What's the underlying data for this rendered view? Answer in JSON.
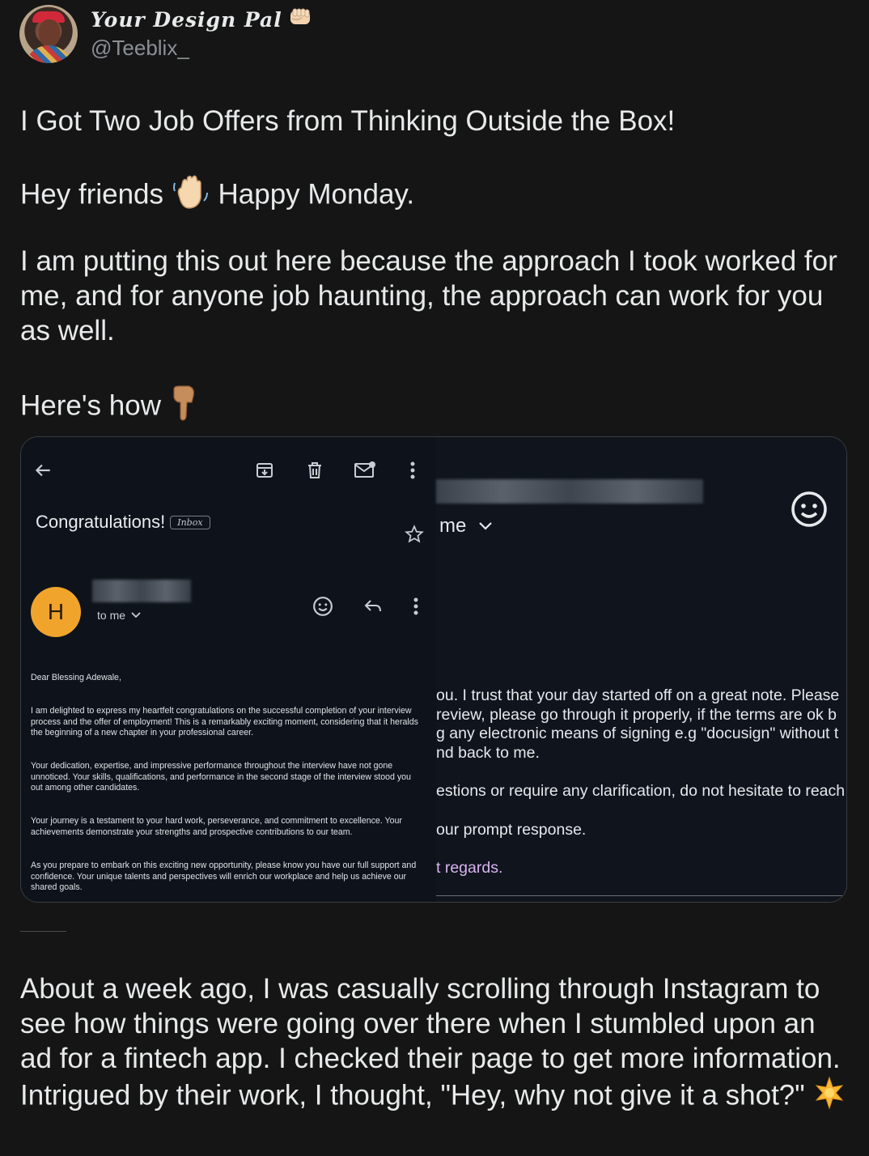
{
  "author": {
    "display_name": "Your Design Pal",
    "handle": "@Teeblix_"
  },
  "post": {
    "headline": "I Got Two Job Offers from Thinking Outside the Box!",
    "greeting_a": "Hey friends",
    "greeting_b": "Happy Monday.",
    "body_1": "I am putting this out here because the approach I took worked for me, and for anyone job haunting, the approach can work for you as well.",
    "cta": "Here's how",
    "body_2": "About a week ago, I was casually scrolling through Instagram to see how things were going over there when I stumbled upon an ad for a fintech app. I checked their page to get more information. Intrigued by their work, I thought, \"Hey, why not give it a shot?\""
  },
  "email_left": {
    "subject": "Congratulations!",
    "label": "Inbox",
    "sender_initial": "H",
    "recipient": "to me",
    "salutation": "Dear Blessing Adewale,",
    "p1": "I am delighted to express my heartfelt congratulations on the successful completion of your interview process and the offer of employment! This is a remarkably exciting moment, considering that it heralds the beginning of a new chapter in your professional career.",
    "p2": "Your dedication, expertise, and impressive performance throughout the interview have not gone unnoticed. Your skills, qualifications, and performance in the second stage of the interview stood you out among other candidates.",
    "p3": "Your journey is a testament to your hard work, perseverance, and commitment to excellence. Your achievements demonstrate your strengths and prospective contributions to our team.",
    "p4": "As you prepare to embark on this exciting new opportunity, please know you have our full support and confidence. Your unique talents and perspectives will enrich our workplace and help us achieve our shared goals."
  },
  "email_right": {
    "recipient": "me",
    "line1": "ou. I trust that your day started off on a great note. Please",
    "line2": "review, please go through it properly, if the terms are ok b",
    "line3": "g any electronic means of signing e.g \"docusign\" without t",
    "line4": "nd back to me.",
    "line5": "estions or require any clarification, do not hesitate to reach",
    "line6": "our prompt response.",
    "line7": "t regards."
  },
  "colors": {
    "background": "#151515",
    "text": "#e7e9ea",
    "muted": "#8b9096",
    "avatar_orange": "#f1a42b",
    "regards_purple": "#d8b4f0"
  }
}
